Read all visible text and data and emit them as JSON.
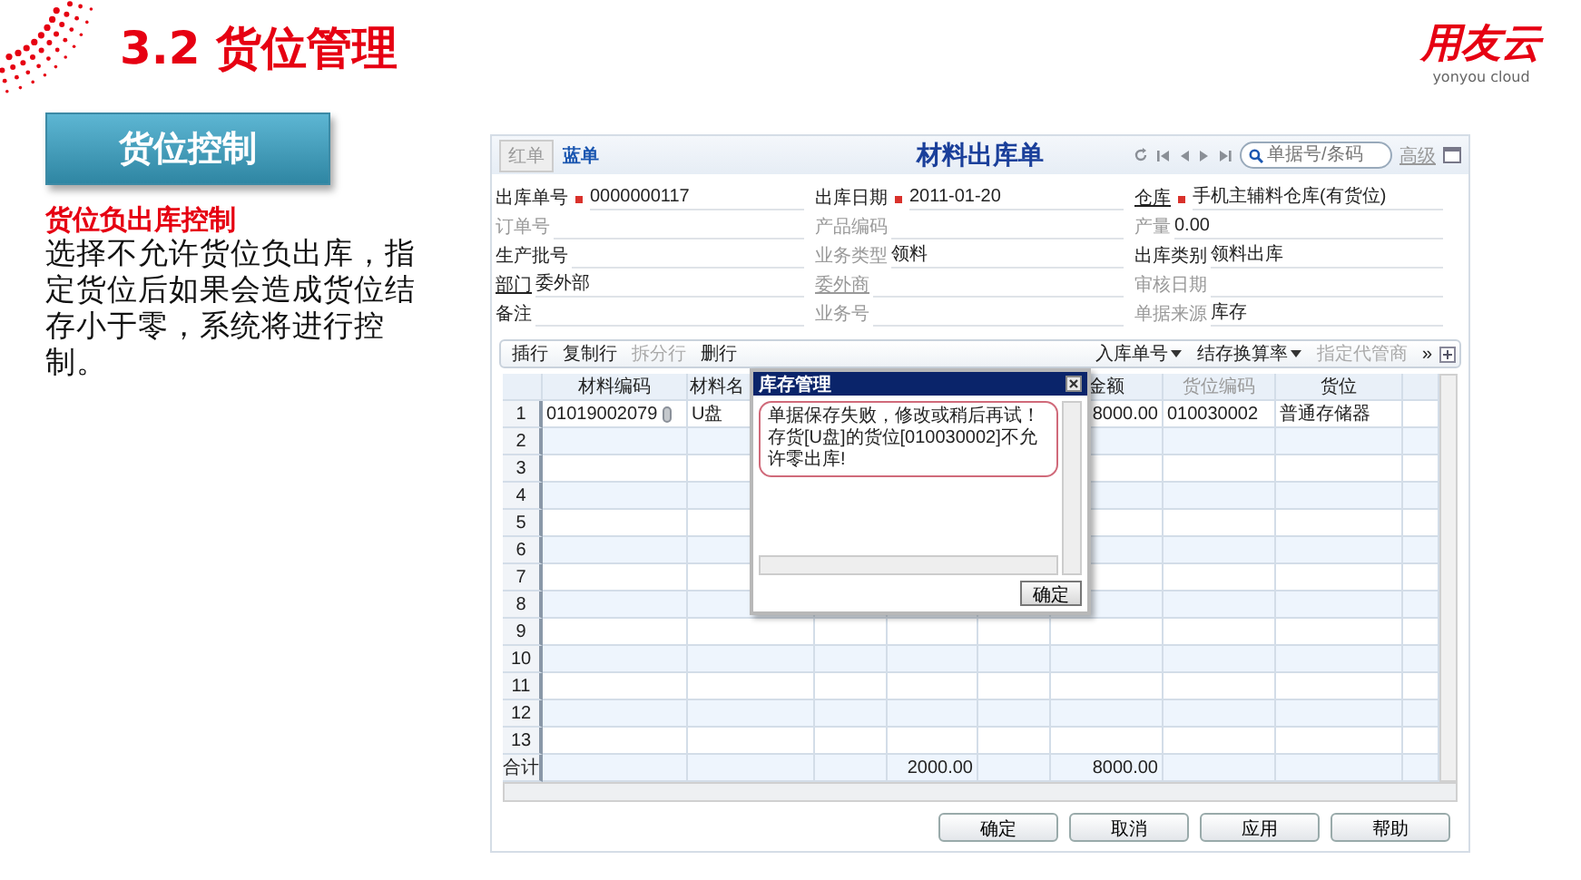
{
  "slide": {
    "title": "3.2 货位管理",
    "logo": "用友云",
    "logo_subtitle": "yonyou cloud",
    "section_label": "货位控制",
    "heading": "货位负出库控制",
    "body": "选择不允许货位负出库，指定货位后如果会造成货位结存小于零，系统将进行控制。"
  },
  "window": {
    "modes": [
      {
        "label": "红单",
        "selected": false
      },
      {
        "label": "蓝单",
        "selected": true
      }
    ],
    "title": "材料出库单",
    "search": {
      "placeholder": "单据号/条码"
    },
    "advanced_link": "高级",
    "form_columns": [
      [
        {
          "label": "出库单号",
          "value": "0000000117",
          "required": true,
          "muted": false,
          "link": false
        },
        {
          "label": "订单号",
          "required": false,
          "muted": true,
          "link": false
        },
        {
          "label": "生产批号",
          "required": false,
          "muted": false,
          "link": false
        },
        {
          "label": "部门",
          "value": "委外部",
          "required": false,
          "muted": false,
          "link": true
        },
        {
          "label": "备注",
          "required": false,
          "muted": false,
          "link": false
        }
      ],
      [
        {
          "label": "出库日期",
          "value": "2011-01-20",
          "required": true,
          "muted": false,
          "link": false
        },
        {
          "label": "产品编码",
          "required": false,
          "muted": true,
          "link": false
        },
        {
          "label": "业务类型",
          "value": "领料",
          "required": false,
          "muted": true,
          "link": false
        },
        {
          "label": "委外商",
          "required": false,
          "muted": true,
          "link": true
        },
        {
          "label": "业务号",
          "required": false,
          "muted": true,
          "link": false
        }
      ],
      [
        {
          "label": "仓库",
          "value": "手机主辅料仓库(有货位)",
          "required": true,
          "muted": false,
          "link": true
        },
        {
          "label": "产量",
          "value": "0.00",
          "required": false,
          "muted": true,
          "link": false
        },
        {
          "label": "出库类别",
          "value": "领料出库",
          "required": false,
          "muted": false,
          "link": false
        },
        {
          "label": "审核日期",
          "required": false,
          "muted": true,
          "link": false
        },
        {
          "label": "单据来源",
          "value": "库存",
          "required": false,
          "muted": true,
          "link": false
        }
      ]
    ],
    "toolbar": {
      "left": [
        {
          "label": "插行",
          "disabled": false,
          "dropdown": false
        },
        {
          "label": "复制行",
          "disabled": false,
          "dropdown": false
        },
        {
          "label": "拆分行",
          "disabled": true,
          "dropdown": false
        },
        {
          "label": "删行",
          "disabled": false,
          "dropdown": false
        }
      ],
      "right": [
        {
          "label": "入库单号",
          "disabled": false,
          "dropdown": true
        },
        {
          "label": "结存换算率",
          "disabled": false,
          "dropdown": true
        },
        {
          "label": "指定代管商",
          "disabled": true,
          "dropdown": false
        },
        {
          "label": "»",
          "disabled": false,
          "dropdown": false
        }
      ]
    },
    "table": {
      "columns": [
        {
          "label": "材料编码",
          "muted": false
        },
        {
          "label": "材料名",
          "muted": false
        },
        null,
        null,
        null,
        {
          "label": "金额",
          "muted": false
        },
        {
          "label": "货位编码",
          "muted": true
        },
        {
          "label": "货位",
          "muted": false
        },
        null
      ],
      "rows": [
        {
          "number": "1",
          "attached": true,
          "cells": [
            "01019002079",
            "U盘",
            null,
            null,
            null,
            "8000.00",
            "010030002",
            "普通存储器",
            null
          ]
        },
        {
          "number": "2",
          "attached": false
        },
        {
          "number": "3",
          "attached": false
        },
        {
          "number": "4",
          "attached": false
        },
        {
          "number": "5",
          "attached": false
        },
        {
          "number": "6",
          "attached": false
        },
        {
          "number": "7",
          "attached": false
        },
        {
          "number": "8",
          "attached": false
        },
        {
          "number": "9",
          "attached": false
        },
        {
          "number": "10",
          "attached": false
        },
        {
          "number": "11",
          "attached": false
        },
        {
          "number": "12",
          "attached": false
        },
        {
          "number": "13",
          "attached": false
        }
      ],
      "total": {
        "label": "合计",
        "cells": [
          null,
          null,
          null,
          "2000.00",
          null,
          "8000.00",
          null,
          null,
          null
        ]
      }
    },
    "buttons": [
      "确定",
      "取消",
      "应用",
      "帮助"
    ]
  },
  "dialog": {
    "title": "库存管理",
    "messages": [
      "单据保存失败，修改或稍后再试！",
      "存货[U盘]的货位[010030002]不允许零出库!"
    ],
    "button": "确定"
  }
}
